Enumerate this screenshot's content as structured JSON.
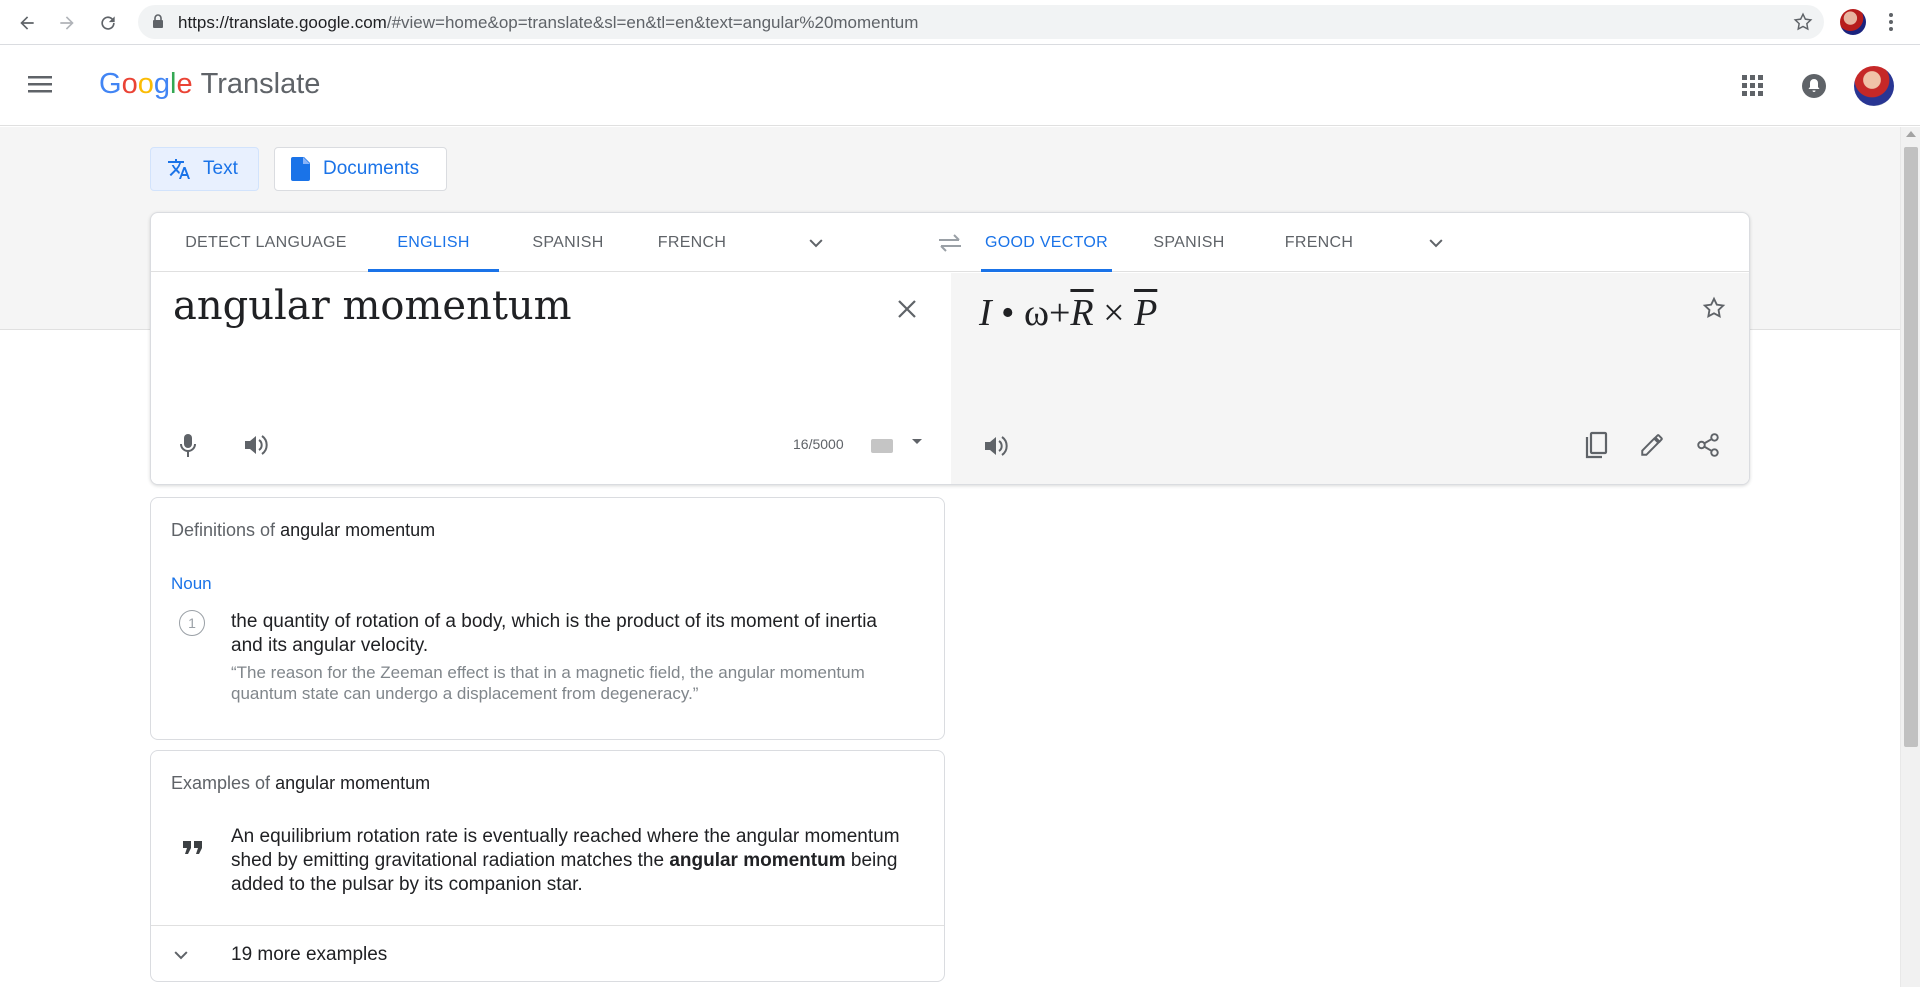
{
  "browser": {
    "url_host": "https://translate.google.com",
    "url_rest": "/#view=home&op=translate&sl=en&tl=en&text=angular%20momentum"
  },
  "header": {
    "logo_letters": [
      "G",
      "o",
      "o",
      "g",
      "l",
      "e"
    ],
    "product": "Translate"
  },
  "modes": {
    "text": "Text",
    "documents": "Documents"
  },
  "source_langs": [
    "DETECT LANGUAGE",
    "ENGLISH",
    "SPANISH",
    "FRENCH"
  ],
  "source_active": "ENGLISH",
  "target_langs": [
    "GOOD VECTOR",
    "SPANISH",
    "FRENCH"
  ],
  "target_active": "GOOD VECTOR",
  "source": {
    "text": "angular momentum",
    "count": "16/5000"
  },
  "target": {
    "formula": {
      "I": "I",
      "dot": "•",
      "omega": "ω",
      "plus": "+",
      "R": "R",
      "times": "×",
      "P": "P"
    }
  },
  "definitions": {
    "title_prefix": "Definitions of",
    "term": "angular momentum",
    "pos": "Noun",
    "items": [
      {
        "num": "1",
        "text": "the quantity of rotation of a body, which is the product of its moment of inertia and its angular velocity.",
        "example": "“The reason for the Zeeman effect is that in a magnetic field, the angular momentum quantum state can undergo a displacement from degeneracy.”"
      }
    ]
  },
  "examples": {
    "title_prefix": "Examples of",
    "term": "angular momentum",
    "item": {
      "before": "An equilibrium rotation rate is eventually reached where the angular momentum shed by emitting gravitational radiation matches the ",
      "bold": "angular momentum",
      "after": " being added to the pulsar by its companion star."
    },
    "more": "19 more examples"
  },
  "colors": {
    "accent": "#1a73e8",
    "pane_gray": "#f5f5f5",
    "text": "#202124",
    "muted": "#5f6368"
  }
}
